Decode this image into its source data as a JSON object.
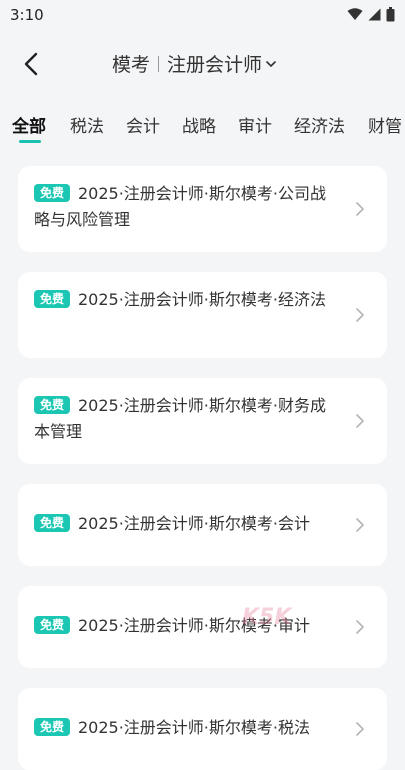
{
  "status": {
    "time": "3:10"
  },
  "header": {
    "mode": "模考",
    "exam": "注册会计师"
  },
  "tabs": [
    {
      "label": "全部",
      "active": true
    },
    {
      "label": "税法"
    },
    {
      "label": "会计"
    },
    {
      "label": "战略"
    },
    {
      "label": "审计"
    },
    {
      "label": "经济法"
    },
    {
      "label": "财管"
    }
  ],
  "badge_label": "免费",
  "exams": [
    {
      "title": "2025·注册会计师·斯尔模考·公司战略与风险管理"
    },
    {
      "title": "2025·注册会计师·斯尔模考·经济法"
    },
    {
      "title": "2025·注册会计师·斯尔模考·财务成本管理"
    },
    {
      "title": "2025·注册会计师·斯尔模考·会计"
    },
    {
      "title": "2025·注册会计师·斯尔模考·审计"
    },
    {
      "title": "2025·注册会计师·斯尔模考·税法"
    }
  ],
  "watermark": "K5K",
  "colors": {
    "accent": "#18c1b0",
    "background": "#f4f5f7"
  }
}
